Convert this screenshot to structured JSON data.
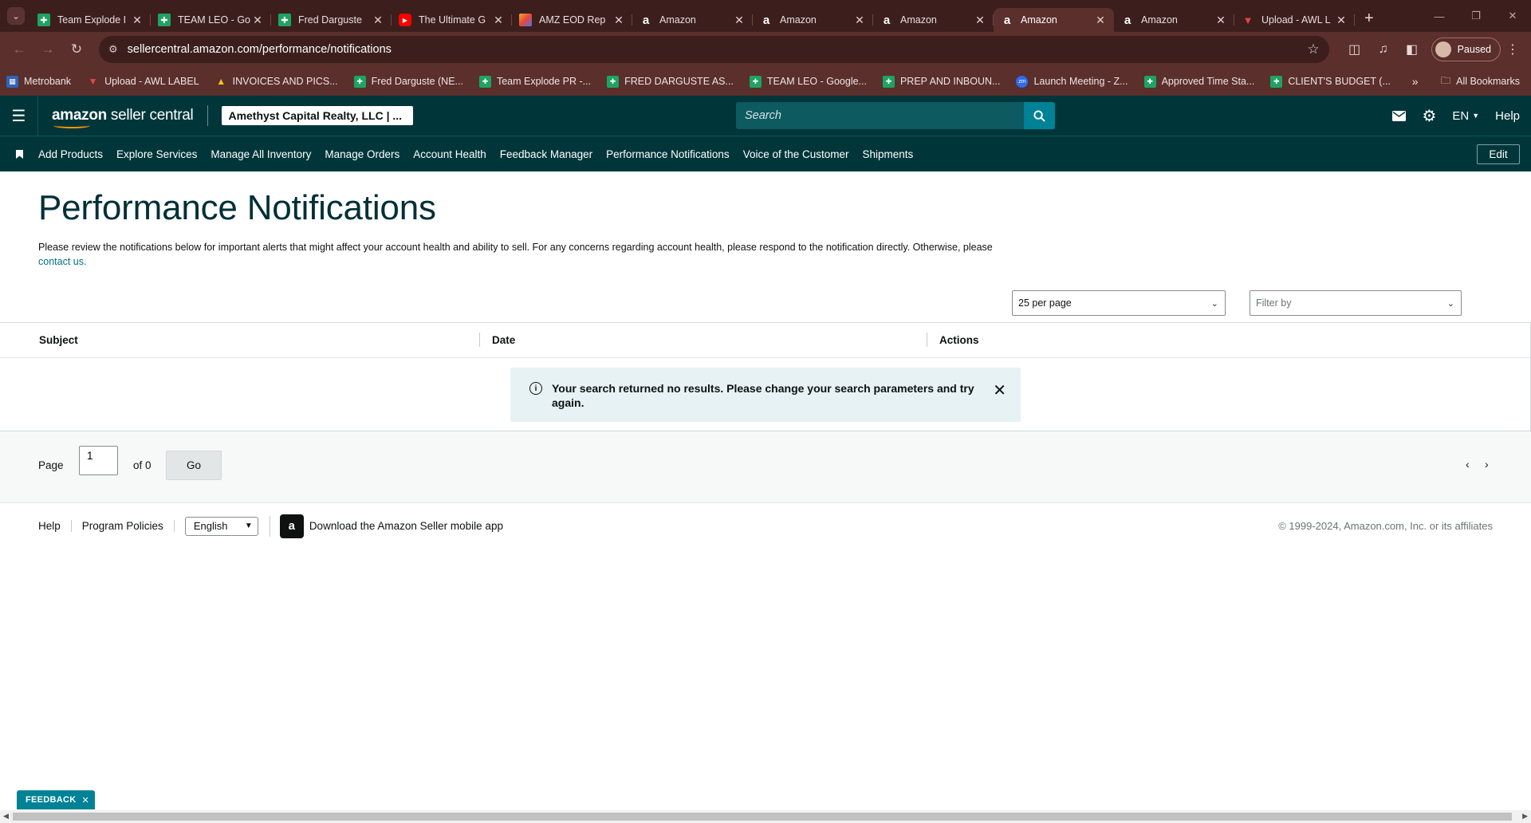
{
  "browser": {
    "tabs": [
      {
        "title": "Team Explode I",
        "icon": "sheets",
        "active": false
      },
      {
        "title": "TEAM LEO - Go",
        "icon": "sheets",
        "active": false
      },
      {
        "title": "Fred Darguste",
        "icon": "sheets",
        "active": false
      },
      {
        "title": "The Ultimate G",
        "icon": "youtube",
        "active": false
      },
      {
        "title": "AMZ EOD Rep",
        "icon": "eod",
        "active": false
      },
      {
        "title": "Amazon",
        "icon": "amazon",
        "active": false
      },
      {
        "title": "Amazon",
        "icon": "amazon",
        "active": false
      },
      {
        "title": "Amazon",
        "icon": "amazon",
        "active": false
      },
      {
        "title": "Amazon",
        "icon": "amazon",
        "active": true
      },
      {
        "title": "Amazon",
        "icon": "amazon",
        "active": false
      },
      {
        "title": "Upload - AWL L",
        "icon": "awl",
        "active": false
      }
    ],
    "url": "sellercentral.amazon.com/performance/notifications",
    "profile_label": "Paused",
    "bookmarks": [
      {
        "label": "Metrobank",
        "icon": "mb"
      },
      {
        "label": "Upload - AWL LABEL",
        "icon": "awl"
      },
      {
        "label": "INVOICES AND PICS...",
        "icon": "drive"
      },
      {
        "label": "Fred Darguste (NE...",
        "icon": "sheets"
      },
      {
        "label": "Team Explode PR -...",
        "icon": "sheets"
      },
      {
        "label": "FRED DARGUSTE AS...",
        "icon": "sheets"
      },
      {
        "label": "TEAM LEO - Google...",
        "icon": "sheets"
      },
      {
        "label": "PREP AND INBOUN...",
        "icon": "sheets"
      },
      {
        "label": "Launch Meeting - Z...",
        "icon": "zm"
      },
      {
        "label": "Approved Time Sta...",
        "icon": "sheets"
      },
      {
        "label": "CLIENT'S BUDGET (...",
        "icon": "sheets"
      }
    ],
    "all_bookmarks_label": "All Bookmarks"
  },
  "header": {
    "logo_bold": "amazon",
    "logo_light": " seller central",
    "account": "Amethyst Capital Realty, LLC | ...",
    "search_placeholder": "Search",
    "language": "EN",
    "help": "Help"
  },
  "nav": {
    "items": [
      "Add Products",
      "Explore Services",
      "Manage All Inventory",
      "Manage Orders",
      "Account Health",
      "Feedback Manager",
      "Performance Notifications",
      "Voice of the Customer",
      "Shipments"
    ],
    "edit_label": "Edit"
  },
  "page": {
    "title": "Performance Notifications",
    "intro": "Please review the notifications below for important alerts that might affect your account health and ability to sell. For any concerns regarding account health, please respond to the notification directly. Otherwise, please",
    "contact_link": "contact us.",
    "per_page": "25 per page",
    "filter_placeholder": "Filter by",
    "table": {
      "columns": [
        "Subject",
        "Date",
        "Actions"
      ]
    },
    "empty_message": "Your search returned no results. Please change your search parameters and try again.",
    "pager": {
      "page_label": "Page",
      "page_value": "1",
      "of_label": "of 0",
      "go_label": "Go"
    }
  },
  "footer": {
    "help": "Help",
    "policies": "Program Policies",
    "language": "English",
    "app_link": "Download the Amazon Seller mobile app",
    "copyright": "© 1999-2024, Amazon.com, Inc. or its affiliates"
  },
  "feedback_label": "FEEDBACK"
}
